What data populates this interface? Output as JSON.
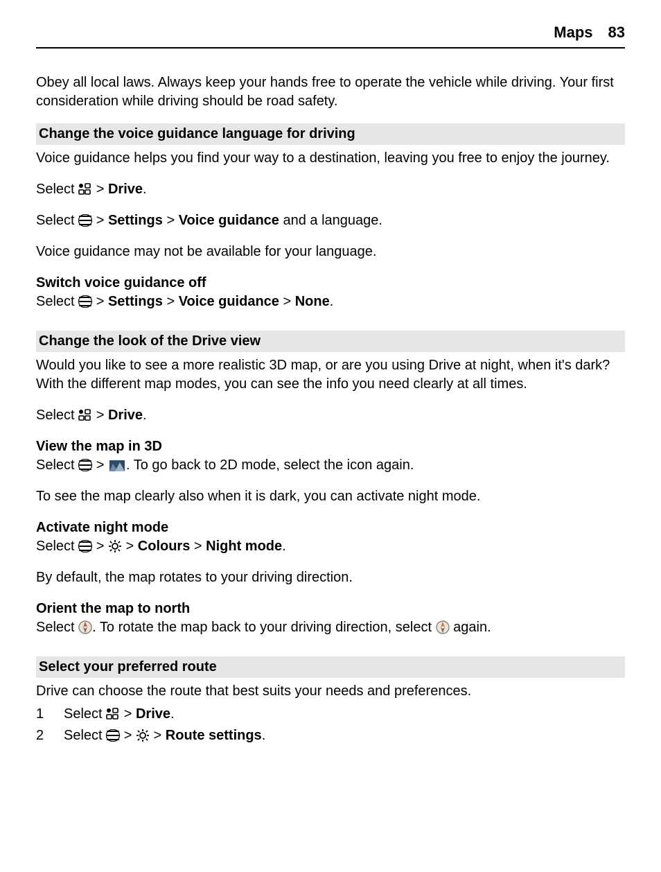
{
  "header": {
    "chapter": "Maps",
    "page": "83"
  },
  "intro": "Obey all local laws. Always keep your hands free to operate the vehicle while driving. Your first consideration while driving should be road safety.",
  "sec1": {
    "title": "Change the voice guidance language for driving",
    "p1": "Voice guidance helps you find your way to a destination, leaving you free to enjoy the journey.",
    "select": "Select ",
    "gt": " > ",
    "drive": "Drive",
    "period": ".",
    "settings": "Settings",
    "voice_guidance": "Voice guidance",
    "and_lang": " and a language.",
    "p2": "Voice guidance may not be available for your language.",
    "sub_off_title": "Switch voice guidance off",
    "none": "None"
  },
  "sec2": {
    "title": "Change the look of the Drive view",
    "p1": "Would you like to see a more realistic 3D map, or are you using Drive at night, when it's dark? With the different map modes, you can see the info you need clearly at all times.",
    "sub_3d_title": "View the map in 3D",
    "rest_3d": ". To go back to 2D mode, select the icon again.",
    "p_dark": "To see the map clearly also when it is dark, you can activate night mode.",
    "sub_night_title": "Activate night mode",
    "colours": "Colours",
    "night_mode": "Night mode",
    "p_rotate": "By default, the map rotates to your driving direction.",
    "sub_orient_title": "Orient the map to north",
    "orient_rest1": ". To rotate the map back to your driving direction, select ",
    "orient_rest2": " again."
  },
  "sec3": {
    "title": "Select your preferred route",
    "p1": "Drive can choose the route that best suits your needs and preferences.",
    "step1_num": "1",
    "step2_num": "2",
    "route_settings": "Route settings"
  }
}
